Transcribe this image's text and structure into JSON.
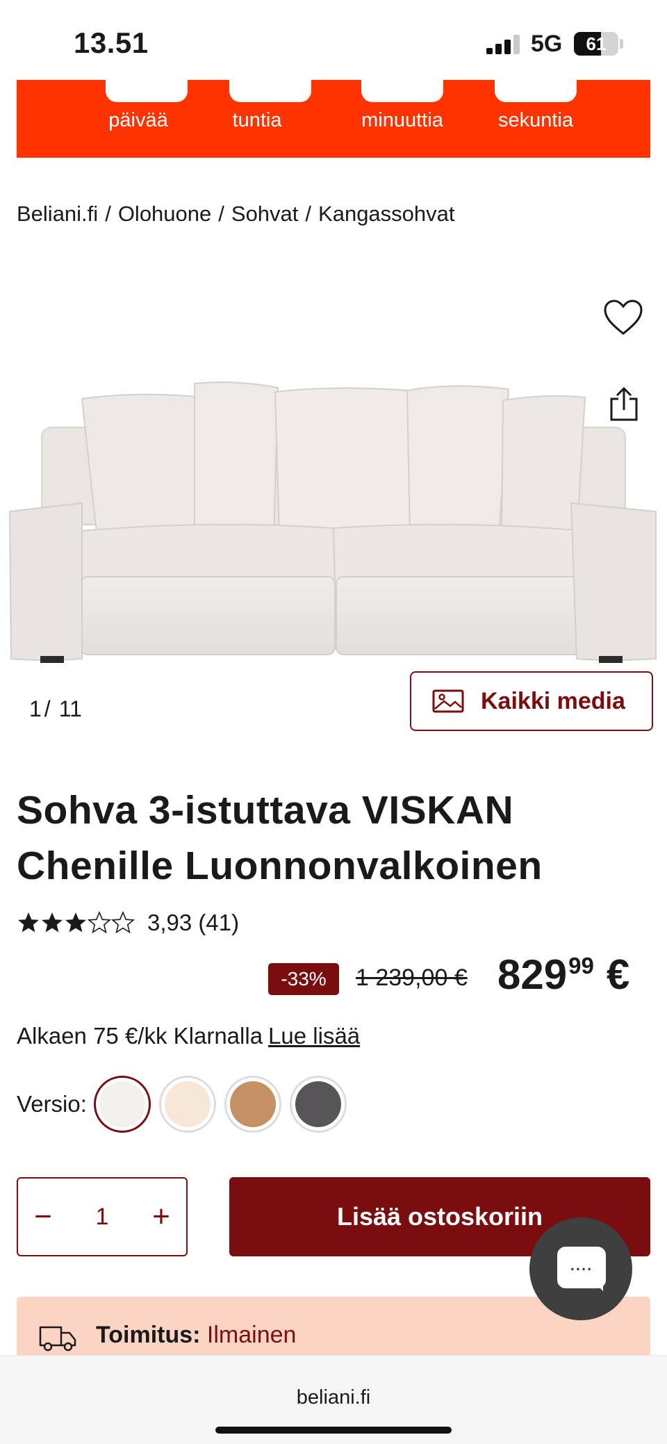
{
  "status_bar": {
    "time": "13.51",
    "network": "5G",
    "battery": "61",
    "battery_level": 0.61
  },
  "countdown": {
    "labels": [
      "päivää",
      "tuntia",
      "minuuttia",
      "sekuntia"
    ],
    "color": "#ff3300"
  },
  "breadcrumb": [
    "Beliani.fi",
    "Olohuone",
    "Sohvat",
    "Kangassohvat"
  ],
  "gallery": {
    "current": "1",
    "separator": "/",
    "total": "11",
    "media_button": "Kaikki media"
  },
  "product": {
    "title_line1": "Sohva 3-istuttava VISKAN",
    "title_line2": "Chenille Luonnonvalkoinen",
    "rating": 3.93,
    "rating_text": "3,93 (41)",
    "discount": "-33%",
    "old_price": "1 239,00 €",
    "price_main": "829",
    "price_cents": "99",
    "currency": "€"
  },
  "klarna": {
    "text": "Alkaen 75 €/kk Klarnalla",
    "link": "Lue lisää"
  },
  "versions": {
    "label": "Versio:",
    "swatches": [
      {
        "color": "#f1f0ed",
        "selected": true
      },
      {
        "color": "#f6e7d8",
        "selected": false
      },
      {
        "color": "#c49064",
        "selected": false
      },
      {
        "color": "#575557",
        "selected": false
      }
    ]
  },
  "quantity": {
    "minus": "−",
    "value": "1",
    "plus": "+"
  },
  "cart_button": "Lisää ostoskoriin",
  "delivery": {
    "label": "Toimitus:",
    "value": "Ilmainen"
  },
  "browser": {
    "url": "beliani.fi"
  },
  "colors": {
    "accent": "#7a0e0e",
    "banner": "#ff3300",
    "delivery_bg": "#fcd4c4"
  }
}
